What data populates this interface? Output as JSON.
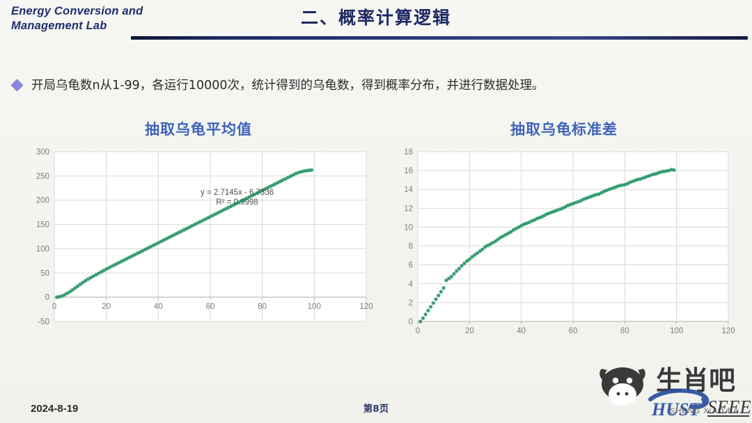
{
  "header": {
    "lab_line1": "Energy Conversion and",
    "lab_line2": "Management Lab",
    "title": "二、概率计算逻辑"
  },
  "bullet": {
    "marker": "diamond-bullet",
    "text": "开局乌龟数n从1-99，各运行10000次，统计得到的乌龟数，得到概率分布，并进行数据处理。"
  },
  "footer": {
    "date": "2024-8-19",
    "page": "第8页"
  },
  "watermark": {
    "brand_cn": "生肖吧",
    "brand_pinyin": "SHENG XIAO BA",
    "logo_main": "HUST",
    "logo_sub": "SEEE",
    "ox_icon": "ox-head-icon"
  },
  "colors": {
    "series_green": "#2e9a6c",
    "title_blue": "#3f63ba",
    "header_navy": "#1c2a63",
    "bullet_purple": "#8b86d8",
    "axis_gray": "#808080",
    "grid_gray": "#d9d9d9"
  },
  "chart_data": [
    {
      "id": "mean",
      "type": "scatter",
      "title": "抽取乌龟平均值",
      "xlabel": "",
      "ylabel": "",
      "xlim": [
        0,
        120
      ],
      "ylim": [
        -50,
        300
      ],
      "xticks": [
        0,
        20,
        40,
        60,
        80,
        100,
        120
      ],
      "yticks": [
        -50,
        0,
        50,
        100,
        150,
        200,
        250,
        300
      ],
      "grid": true,
      "legend": "none",
      "annotations": [
        "y = 2.7145x - 6.7336",
        "R² = 0.9998"
      ],
      "trendline": {
        "slope": 2.7145,
        "intercept": -6.7336,
        "r2": 0.9998
      },
      "series": [
        {
          "name": "抽取乌龟平均值",
          "color": "#2e9a6c",
          "x": [
            1,
            2,
            3,
            4,
            5,
            6,
            7,
            8,
            9,
            10,
            11,
            12,
            13,
            14,
            15,
            16,
            17,
            18,
            19,
            20,
            21,
            22,
            23,
            24,
            25,
            26,
            27,
            28,
            29,
            30,
            31,
            32,
            33,
            34,
            35,
            36,
            37,
            38,
            39,
            40,
            41,
            42,
            43,
            44,
            45,
            46,
            47,
            48,
            49,
            50,
            51,
            52,
            53,
            54,
            55,
            56,
            57,
            58,
            59,
            60,
            61,
            62,
            63,
            64,
            65,
            66,
            67,
            68,
            69,
            70,
            71,
            72,
            73,
            74,
            75,
            76,
            77,
            78,
            79,
            80,
            81,
            82,
            83,
            84,
            85,
            86,
            87,
            88,
            89,
            90,
            91,
            92,
            93,
            94,
            95,
            96,
            97,
            98,
            99
          ],
          "y": [
            0.0,
            0.9,
            2.6,
            5.0,
            8.0,
            11.4,
            15.0,
            18.8,
            22.7,
            26.6,
            30.4,
            33.9,
            37.2,
            40.3,
            43.3,
            46.2,
            49.1,
            52.0,
            54.9,
            57.8,
            60.6,
            63.4,
            66.1,
            68.8,
            71.5,
            74.2,
            76.9,
            79.6,
            82.3,
            85.0,
            87.7,
            90.4,
            93.1,
            95.8,
            98.5,
            101.2,
            103.9,
            106.6,
            109.3,
            112.0,
            114.7,
            117.4,
            120.1,
            122.8,
            125.5,
            128.2,
            130.9,
            133.6,
            136.3,
            139.0,
            141.7,
            144.4,
            147.1,
            149.8,
            152.5,
            155.2,
            157.9,
            160.6,
            163.3,
            166.0,
            168.7,
            171.4,
            174.1,
            176.8,
            179.5,
            182.2,
            184.9,
            187.6,
            190.3,
            193.0,
            195.7,
            198.4,
            201.1,
            203.8,
            206.5,
            209.2,
            211.9,
            214.6,
            217.3,
            220.0,
            222.7,
            225.4,
            228.1,
            230.8,
            233.5,
            236.2,
            238.9,
            241.6,
            244.3,
            247.0,
            249.7,
            252.4,
            255.1,
            257.0,
            258.6,
            259.9,
            260.9,
            261.6,
            262.2
          ]
        }
      ]
    },
    {
      "id": "stdev",
      "type": "scatter",
      "title": "抽取乌龟标准差",
      "xlabel": "",
      "ylabel": "",
      "xlim": [
        0,
        120
      ],
      "ylim": [
        0,
        18
      ],
      "xticks": [
        0,
        20,
        40,
        60,
        80,
        100,
        120
      ],
      "yticks": [
        0,
        2,
        4,
        6,
        8,
        10,
        12,
        14,
        16,
        18
      ],
      "grid": true,
      "legend": "none",
      "annotations": [],
      "series": [
        {
          "name": "抽取乌龟标准差",
          "color": "#2e9a6c",
          "x": [
            1,
            2,
            3,
            4,
            5,
            6,
            7,
            8,
            9,
            10,
            11,
            12,
            13,
            14,
            15,
            16,
            17,
            18,
            19,
            20,
            21,
            22,
            23,
            24,
            25,
            26,
            27,
            28,
            29,
            30,
            31,
            32,
            33,
            34,
            35,
            36,
            37,
            38,
            39,
            40,
            41,
            42,
            43,
            44,
            45,
            46,
            47,
            48,
            49,
            50,
            51,
            52,
            53,
            54,
            55,
            56,
            57,
            58,
            59,
            60,
            61,
            62,
            63,
            64,
            65,
            66,
            67,
            68,
            69,
            70,
            71,
            72,
            73,
            74,
            75,
            76,
            77,
            78,
            79,
            80,
            81,
            82,
            83,
            84,
            85,
            86,
            87,
            88,
            89,
            90,
            91,
            92,
            93,
            94,
            95,
            96,
            97,
            98,
            99
          ],
          "y": [
            0.0,
            0.35,
            0.75,
            1.15,
            1.55,
            1.95,
            2.35,
            2.75,
            3.15,
            3.55,
            4.35,
            4.55,
            4.75,
            5.05,
            5.35,
            5.6,
            5.9,
            6.15,
            6.4,
            6.6,
            6.85,
            7.05,
            7.25,
            7.45,
            7.65,
            7.9,
            8.05,
            8.2,
            8.35,
            8.5,
            8.7,
            8.9,
            9.05,
            9.2,
            9.35,
            9.5,
            9.7,
            9.85,
            10.0,
            10.15,
            10.3,
            10.4,
            10.5,
            10.65,
            10.75,
            10.9,
            11.0,
            11.1,
            11.25,
            11.4,
            11.5,
            11.6,
            11.7,
            11.8,
            11.9,
            12.0,
            12.15,
            12.3,
            12.4,
            12.5,
            12.6,
            12.7,
            12.8,
            12.95,
            13.05,
            13.15,
            13.25,
            13.35,
            13.45,
            13.5,
            13.65,
            13.8,
            13.9,
            14.0,
            14.1,
            14.2,
            14.3,
            14.4,
            14.45,
            14.5,
            14.6,
            14.75,
            14.85,
            14.95,
            15.05,
            15.1,
            15.2,
            15.3,
            15.4,
            15.5,
            15.6,
            15.65,
            15.75,
            15.85,
            15.9,
            15.95,
            16.0,
            16.1,
            16.05
          ]
        }
      ]
    }
  ]
}
